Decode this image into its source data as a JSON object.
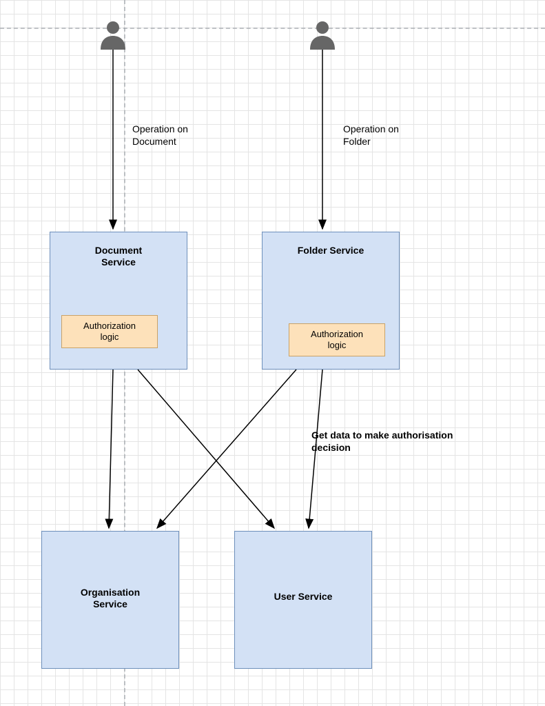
{
  "actors": {
    "left_label": "Operation on\nDocument",
    "right_label": "Operation on\nFolder"
  },
  "services": {
    "document": {
      "title": "Document\nService",
      "inner": "Authorization\nlogic"
    },
    "folder": {
      "title": "Folder Service",
      "inner": "Authorization\nlogic"
    },
    "organisation": {
      "title": "Organisation\nService"
    },
    "user": {
      "title": "User Service"
    }
  },
  "flow_label": "Get data to make authorisation\ndecision"
}
